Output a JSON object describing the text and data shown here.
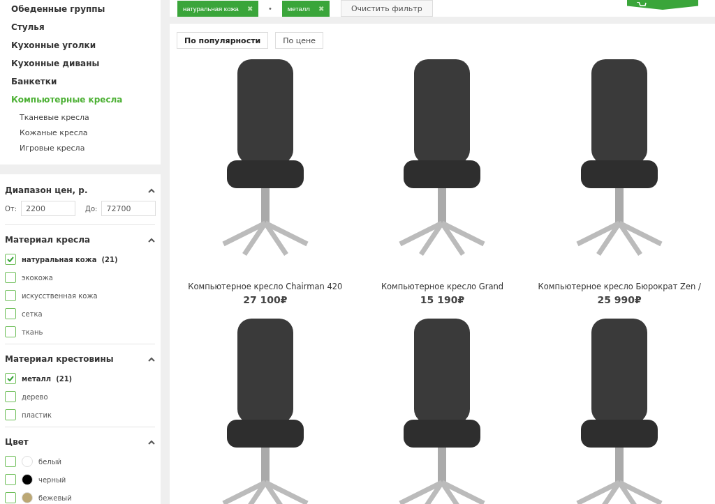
{
  "categories": [
    {
      "label": "Обеденные группы",
      "selected": false
    },
    {
      "label": "Стулья",
      "selected": false
    },
    {
      "label": "Кухонные уголки",
      "selected": false
    },
    {
      "label": "Кухонные диваны",
      "selected": false
    },
    {
      "label": "Банкетки",
      "selected": false
    },
    {
      "label": "Компьютерные кресла",
      "selected": true,
      "children": [
        {
          "label": "Тканевые кресла"
        },
        {
          "label": "Кожаные кресла"
        },
        {
          "label": "Игровые кресла"
        }
      ]
    }
  ],
  "filters": {
    "price": {
      "title": "Диапазон цен, р.",
      "from_label": "От:",
      "from_value": "2200",
      "to_label": "До:",
      "to_value": "72700"
    },
    "groups": [
      {
        "title": "Материал кресла",
        "options": [
          {
            "label": "натуральная кожа",
            "count": "(21)",
            "checked": true
          },
          {
            "label": "экокожа",
            "checked": false
          },
          {
            "label": "искусственная кожа",
            "checked": false
          },
          {
            "label": "сетка",
            "checked": false
          },
          {
            "label": "ткань",
            "checked": false
          }
        ]
      },
      {
        "title": "Материал крестовины",
        "options": [
          {
            "label": "металл",
            "count": "(21)",
            "checked": true
          },
          {
            "label": "дерево",
            "checked": false
          },
          {
            "label": "пластик",
            "checked": false
          }
        ]
      },
      {
        "title": "Цвет",
        "options": [
          {
            "label": "белый",
            "checked": false,
            "color": "#ffffff"
          },
          {
            "label": "черный",
            "checked": false,
            "color": "#000000"
          },
          {
            "label": "бежевый",
            "checked": false,
            "color": "#bba774"
          }
        ]
      }
    ]
  },
  "active_filters": {
    "tags": [
      {
        "label": "натуральная кожа",
        "remove": "✖"
      },
      {
        "label": "металл",
        "remove": "✖"
      }
    ],
    "separator": "•",
    "clear_button": "Очистить фильтр"
  },
  "sort": [
    {
      "label": "По популярности",
      "selected": true
    },
    {
      "label": "По цене",
      "selected": false
    }
  ],
  "products": [
    {
      "kind": "full",
      "title": "Компьютерное кресло Chairman 420",
      "price": "27 100₽"
    },
    {
      "kind": "full",
      "title": "Компьютерное кресло Grand",
      "price": "15 190₽"
    },
    {
      "kind": "full",
      "title": "Компьютерное кресло Бюрократ Zen /",
      "price": "25 990₽"
    },
    {
      "kind": "cut"
    },
    {
      "kind": "cut"
    },
    {
      "kind": "cut"
    }
  ]
}
